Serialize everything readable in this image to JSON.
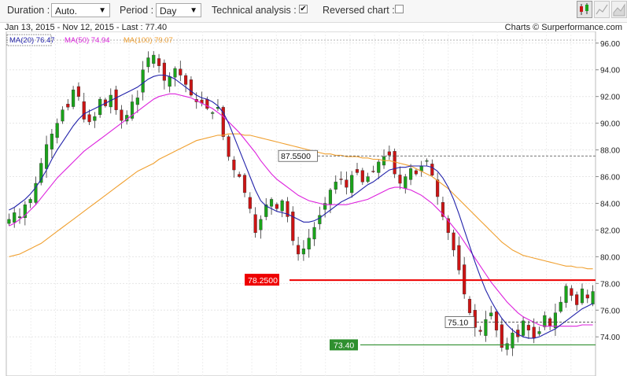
{
  "toolbar": {
    "duration_label": "Duration :",
    "duration_value": "Auto.",
    "period_label": "Period :",
    "period_value": "Day",
    "technical_label": "Technical analysis :",
    "technical_checked": true,
    "reversed_label": "Reversed chart :",
    "reversed_checked": false,
    "chart_type_icons": [
      "candlestick-icon",
      "line-chart-icon",
      "area-chart-icon"
    ]
  },
  "info": {
    "range": "Jan 13, 2015 - Nov 12, 2015 - Last : 77.40",
    "credit": "Charts © Surperformance.com"
  },
  "legend": {
    "ma20": "MA(20) 76.47",
    "ma50": "MA(50) 74.94",
    "ma100": "MA(100) 79.07"
  },
  "colors": {
    "up": "#1aa31a",
    "down": "#cc1414",
    "ma20": "#2222aa",
    "ma50": "#dd22dd",
    "ma100": "#f0a030",
    "resistance": "#ee0000",
    "support": "#2f8f2f"
  },
  "chart_data": {
    "type": "candlestick",
    "ylim": [
      72.6,
      96.4
    ],
    "y_ticks": [
      "96.00",
      "94.00",
      "92.00",
      "90.00",
      "88.00",
      "86.00",
      "84.00",
      "82.00",
      "80.00",
      "78.00",
      "76.00",
      "74.00"
    ],
    "closes": [
      82.8,
      83.3,
      83.0,
      83.9,
      84.3,
      85.5,
      87.0,
      88.4,
      89.2,
      90.0,
      91.0,
      91.2,
      92.5,
      92.0,
      90.3,
      90.1,
      90.5,
      91.8,
      91.3,
      92.1,
      91.0,
      90.2,
      90.6,
      91.6,
      91.9,
      94.0,
      94.9,
      95.1,
      94.3,
      93.2,
      93.5,
      94.1,
      93.6,
      92.9,
      92.1,
      91.6,
      91.5,
      91.1,
      90.8,
      91.2,
      89.0,
      87.5,
      86.5,
      86.0,
      84.8,
      83.6,
      81.8,
      82.8,
      83.9,
      84.3,
      83.6,
      84.2,
      83.0,
      81.2,
      80.2,
      80.6,
      81.4,
      82.2,
      83.1,
      84.0,
      85.0,
      85.6,
      85.8,
      85.2,
      86.1,
      86.3,
      85.6,
      86.0,
      86.4,
      87.1,
      87.5,
      87.6,
      86.2,
      85.5,
      86.0,
      86.6,
      86.2,
      86.8,
      87.2,
      86.1,
      84.5,
      83.0,
      81.8,
      80.5,
      79.0,
      77.2,
      75.8,
      74.7,
      74.4,
      75.3,
      75.8,
      74.5,
      73.2,
      73.5,
      74.3,
      74.0,
      75.2,
      74.5,
      73.9,
      74.4,
      75.6,
      74.8,
      75.8,
      76.6,
      77.8,
      77.1,
      76.4,
      77.6,
      76.9,
      77.4
    ],
    "ma20": [
      83.5,
      83.7,
      84.0,
      84.3,
      84.7,
      85.2,
      85.8,
      86.5,
      87.3,
      88.0,
      88.6,
      89.2,
      89.8,
      90.3,
      90.7,
      90.9,
      91.1,
      91.3,
      91.5,
      91.7,
      91.9,
      92.1,
      92.3,
      92.5,
      92.7,
      93.0,
      93.3,
      93.5,
      93.6,
      93.6,
      93.5,
      93.3,
      93.0,
      92.7,
      92.4,
      92.1,
      91.9,
      91.8,
      91.6,
      91.3,
      90.8,
      90.0,
      89.0,
      88.0,
      87.0,
      86.0,
      85.0,
      84.2,
      83.8,
      83.6,
      83.4,
      83.3,
      83.2,
      83.0,
      82.8,
      82.6,
      82.6,
      82.7,
      82.9,
      83.2,
      83.5,
      83.8,
      84.1,
      84.3,
      84.5,
      84.8,
      85.1,
      85.4,
      85.6,
      85.9,
      86.2,
      86.5,
      86.6,
      86.7,
      86.7,
      86.8,
      86.8,
      86.8,
      86.8,
      86.7,
      86.4,
      85.9,
      85.2,
      84.3,
      83.2,
      82.0,
      80.8,
      79.6,
      78.5,
      77.5,
      76.7,
      76.0,
      75.4,
      74.9,
      74.5,
      74.2,
      74.0,
      73.9,
      73.9,
      74.0,
      74.2,
      74.4,
      74.6,
      74.9,
      75.2,
      75.5,
      75.8,
      76.1,
      76.3,
      76.5
    ],
    "ma50": [
      82.3,
      82.5,
      82.8,
      83.1,
      83.5,
      83.9,
      84.4,
      84.9,
      85.4,
      85.9,
      86.3,
      86.7,
      87.1,
      87.5,
      87.9,
      88.2,
      88.5,
      88.8,
      89.1,
      89.4,
      89.7,
      90.0,
      90.3,
      90.6,
      90.9,
      91.2,
      91.5,
      91.8,
      92.0,
      92.1,
      92.2,
      92.2,
      92.1,
      92.0,
      91.9,
      91.7,
      91.5,
      91.3,
      91.1,
      90.8,
      90.5,
      90.1,
      89.7,
      89.3,
      88.8,
      88.3,
      87.8,
      87.2,
      86.7,
      86.2,
      85.8,
      85.5,
      85.2,
      84.9,
      84.6,
      84.4,
      84.2,
      84.1,
      84.0,
      83.9,
      83.9,
      83.9,
      83.9,
      83.9,
      84.0,
      84.1,
      84.2,
      84.3,
      84.5,
      84.7,
      84.9,
      85.1,
      85.2,
      85.2,
      85.1,
      85.0,
      84.8,
      84.6,
      84.3,
      84.0,
      83.6,
      83.2,
      82.7,
      82.2,
      81.7,
      81.1,
      80.5,
      79.9,
      79.3,
      78.7,
      78.1,
      77.6,
      77.1,
      76.6,
      76.2,
      75.8,
      75.5,
      75.3,
      75.1,
      74.9,
      74.8,
      74.8,
      74.8,
      74.8,
      74.8,
      74.8,
      74.8,
      74.9,
      74.9,
      74.9
    ],
    "ma100": [
      80.0,
      80.1,
      80.2,
      80.4,
      80.6,
      80.8,
      81.0,
      81.3,
      81.6,
      81.9,
      82.2,
      82.5,
      82.8,
      83.1,
      83.4,
      83.7,
      84.0,
      84.3,
      84.6,
      84.9,
      85.2,
      85.5,
      85.8,
      86.1,
      86.4,
      86.6,
      86.8,
      87.0,
      87.3,
      87.5,
      87.7,
      87.9,
      88.1,
      88.3,
      88.5,
      88.7,
      88.8,
      88.9,
      89.0,
      89.1,
      89.1,
      89.2,
      89.2,
      89.2,
      89.1,
      89.1,
      89.0,
      88.9,
      88.8,
      88.7,
      88.6,
      88.5,
      88.4,
      88.3,
      88.2,
      88.1,
      88.0,
      87.9,
      87.8,
      87.7,
      87.7,
      87.6,
      87.6,
      87.5,
      87.5,
      87.5,
      87.4,
      87.4,
      87.3,
      87.3,
      87.2,
      87.2,
      87.1,
      87.0,
      86.9,
      86.8,
      86.6,
      86.4,
      86.2,
      86.0,
      85.7,
      85.4,
      85.1,
      84.7,
      84.3,
      83.9,
      83.5,
      83.1,
      82.7,
      82.3,
      81.9,
      81.5,
      81.1,
      80.8,
      80.5,
      80.3,
      80.1,
      80.0,
      79.9,
      79.8,
      79.7,
      79.6,
      79.5,
      79.4,
      79.3,
      79.3,
      79.2,
      79.2,
      79.1,
      79.1
    ],
    "levels": [
      {
        "value": 87.55,
        "label": "87.5500",
        "style": "dashed"
      },
      {
        "value": 78.25,
        "label": "78.2500",
        "style": "resistance"
      },
      {
        "value": 75.1,
        "label": "75.10",
        "style": "dashed"
      },
      {
        "value": 73.4,
        "label": "73.40",
        "style": "support"
      }
    ]
  }
}
